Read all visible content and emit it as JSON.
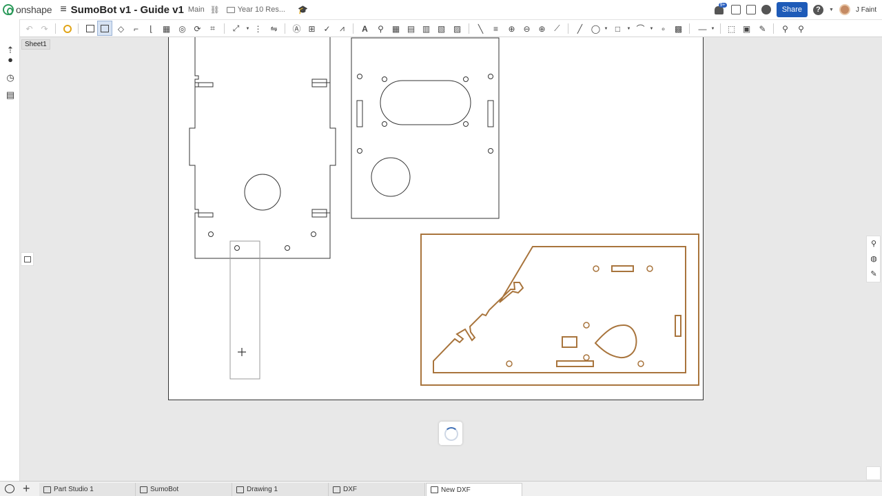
{
  "header": {
    "brand": "onshape",
    "document_title": "SumoBot v1 - Guide v1",
    "branch": "Main",
    "folder": "Year 10 Res...",
    "notification_badge": "9+",
    "share_label": "Share",
    "user_name": "J Faint"
  },
  "sheet": {
    "tab_label": "Sheet1"
  },
  "tabs": [
    {
      "label": "Part Studio 1",
      "icon": "part-studio-icon"
    },
    {
      "label": "SumoBot",
      "icon": "assembly-icon"
    },
    {
      "label": "Drawing 1",
      "icon": "drawing-icon"
    },
    {
      "label": "DXF",
      "icon": "drawing-icon"
    },
    {
      "label": "New DXF",
      "icon": "drawing-icon",
      "active": true
    }
  ],
  "colors": {
    "accent": "#1e5bb8",
    "highlight_stroke": "#a8743c",
    "drawing_stroke": "#333333",
    "onshape_green": "#2c9a5b"
  }
}
